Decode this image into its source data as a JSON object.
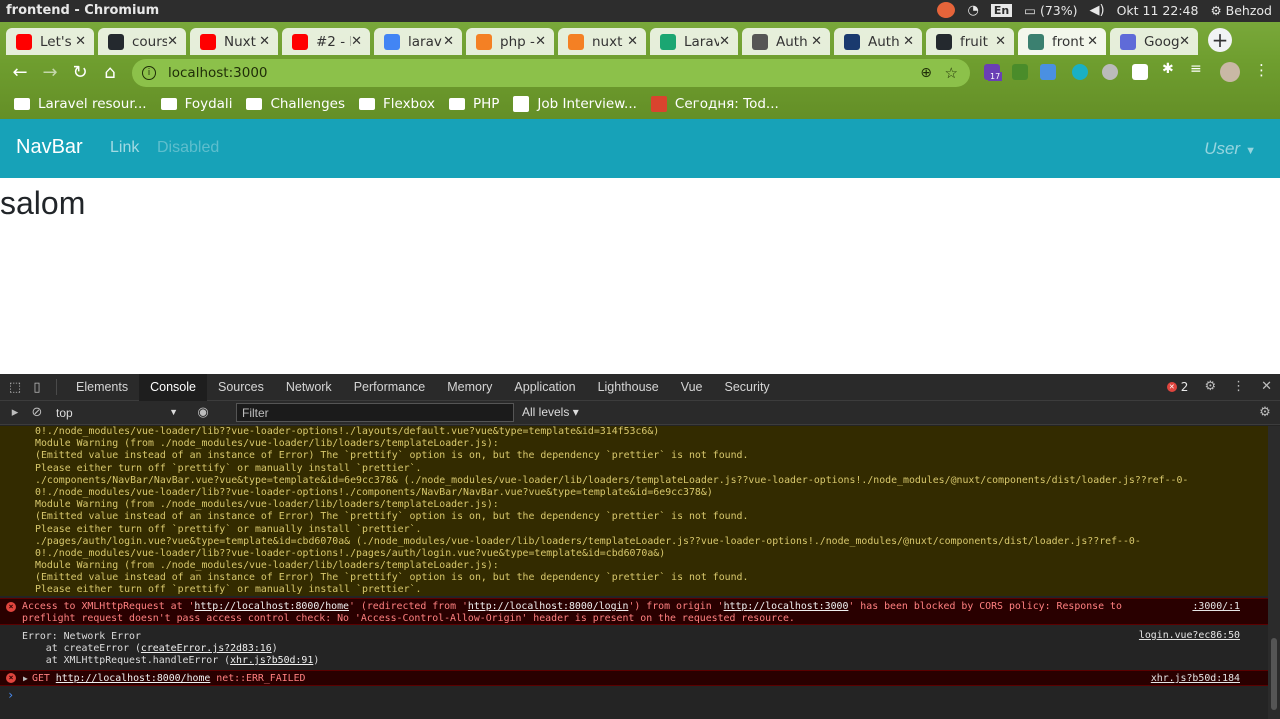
{
  "os": {
    "window_title": "frontend - Chromium",
    "language": "En",
    "battery": "(73%)",
    "datetime": "Okt 11  22:48",
    "user": "Behzod"
  },
  "tabs": [
    {
      "label": "Let's",
      "color": "#ff0000"
    },
    {
      "label": "cours",
      "color": "#24292e"
    },
    {
      "label": "Nuxt",
      "color": "#ff0000"
    },
    {
      "label": "#2 - L",
      "color": "#ff0000"
    },
    {
      "label": "larav",
      "color": "#4285f4"
    },
    {
      "label": "php -",
      "color": "#f48024"
    },
    {
      "label": "nuxt",
      "color": "#f48024"
    },
    {
      "label": "Larav",
      "color": "#1ba672"
    },
    {
      "label": "Auth",
      "color": "#555555"
    },
    {
      "label": "Auth",
      "color": "#1a3a6e"
    },
    {
      "label": "fruit",
      "color": "#24292e"
    },
    {
      "label": "front",
      "color": "#3b8070",
      "active": true
    },
    {
      "label": "Goog",
      "color": "#5f6bd8"
    }
  ],
  "toolbar": {
    "url": "localhost:3000",
    "ext_badge": "17"
  },
  "bookmarks": [
    {
      "label": "Laravel resour...",
      "type": "folder"
    },
    {
      "label": "Foydali",
      "type": "folder"
    },
    {
      "label": "Challenges",
      "type": "folder"
    },
    {
      "label": "Flexbox",
      "type": "folder"
    },
    {
      "label": "PHP",
      "type": "folder"
    },
    {
      "label": "Job Interview...",
      "type": "site"
    },
    {
      "label": "Сегодня: Tod...",
      "type": "site"
    }
  ],
  "page": {
    "brand": "NavBar",
    "link": "Link",
    "disabled": "Disabled",
    "user": "User",
    "greeting": "salom",
    "navbar_color": "#17a2b8"
  },
  "devtools": {
    "tabs": [
      "Elements",
      "Console",
      "Sources",
      "Network",
      "Performance",
      "Memory",
      "Application",
      "Lighthouse",
      "Vue",
      "Security"
    ],
    "active_tab": "Console",
    "error_count": "2",
    "context": "top",
    "filter_placeholder": "Filter",
    "levels": "All levels",
    "warnings": [
      "0!./node_modules/vue-loader/lib??vue-loader-options!./layouts/default.vue?vue&type=template&id=314f53c6&)",
      "Module Warning (from ./node_modules/vue-loader/lib/loaders/templateLoader.js):",
      "(Emitted value instead of an instance of Error) The `prettify` option is on, but the dependency `prettier` is not found.",
      "Please either turn off `prettify` or manually install `prettier`.",
      "./components/NavBar/NavBar.vue?vue&type=template&id=6e9cc378& (./node_modules/vue-loader/lib/loaders/templateLoader.js??vue-loader-options!./node_modules/@nuxt/components/dist/loader.js??ref--0-",
      "0!./node_modules/vue-loader/lib??vue-loader-options!./components/NavBar/NavBar.vue?vue&type=template&id=6e9cc378&)",
      "Module Warning (from ./node_modules/vue-loader/lib/loaders/templateLoader.js):",
      "(Emitted value instead of an instance of Error) The `prettify` option is on, but the dependency `prettier` is not found.",
      "Please either turn off `prettify` or manually install `prettier`.",
      "./pages/auth/login.vue?vue&type=template&id=cbd6070a& (./node_modules/vue-loader/lib/loaders/templateLoader.js??vue-loader-options!./node_modules/@nuxt/components/dist/loader.js??ref--0-",
      "0!./node_modules/vue-loader/lib??vue-loader-options!./pages/auth/login.vue?vue&type=template&id=cbd6070a&)",
      "Module Warning (from ./node_modules/vue-loader/lib/loaders/templateLoader.js):",
      "(Emitted value instead of an instance of Error) The `prettify` option is on, but the dependency `prettier` is not found.",
      "Please either turn off `prettify` or manually install `prettier`."
    ],
    "cors_error": {
      "p1": "Access to XMLHttpRequest at '",
      "url1": "http://localhost:8000/home",
      "p2": "' (redirected from '",
      "url2": "http://localhost:8000/login",
      "p3": "') from origin '",
      "url3": "http://localhost:3000",
      "p4": "' has been blocked by CORS policy: Response to",
      "line2": "preflight request doesn't pass access control check: No 'Access-Control-Allow-Origin' header is present on the requested resource.",
      "source": ":3000/:1"
    },
    "network_error": {
      "line1": "Error: Network Error",
      "line2a": "    at createError (",
      "line2link": "createError.js?2d83:16",
      "line2b": ")",
      "line3a": "    at XMLHttpRequest.handleError (",
      "line3link": "xhr.js?b50d:91",
      "line3b": ")",
      "source": "login.vue?ec86:50"
    },
    "get_error": {
      "prefix": "GET ",
      "url": "http://localhost:8000/home",
      "suffix": " net::ERR_FAILED",
      "source": "xhr.js?b50d:184"
    },
    "prompt": "›"
  }
}
